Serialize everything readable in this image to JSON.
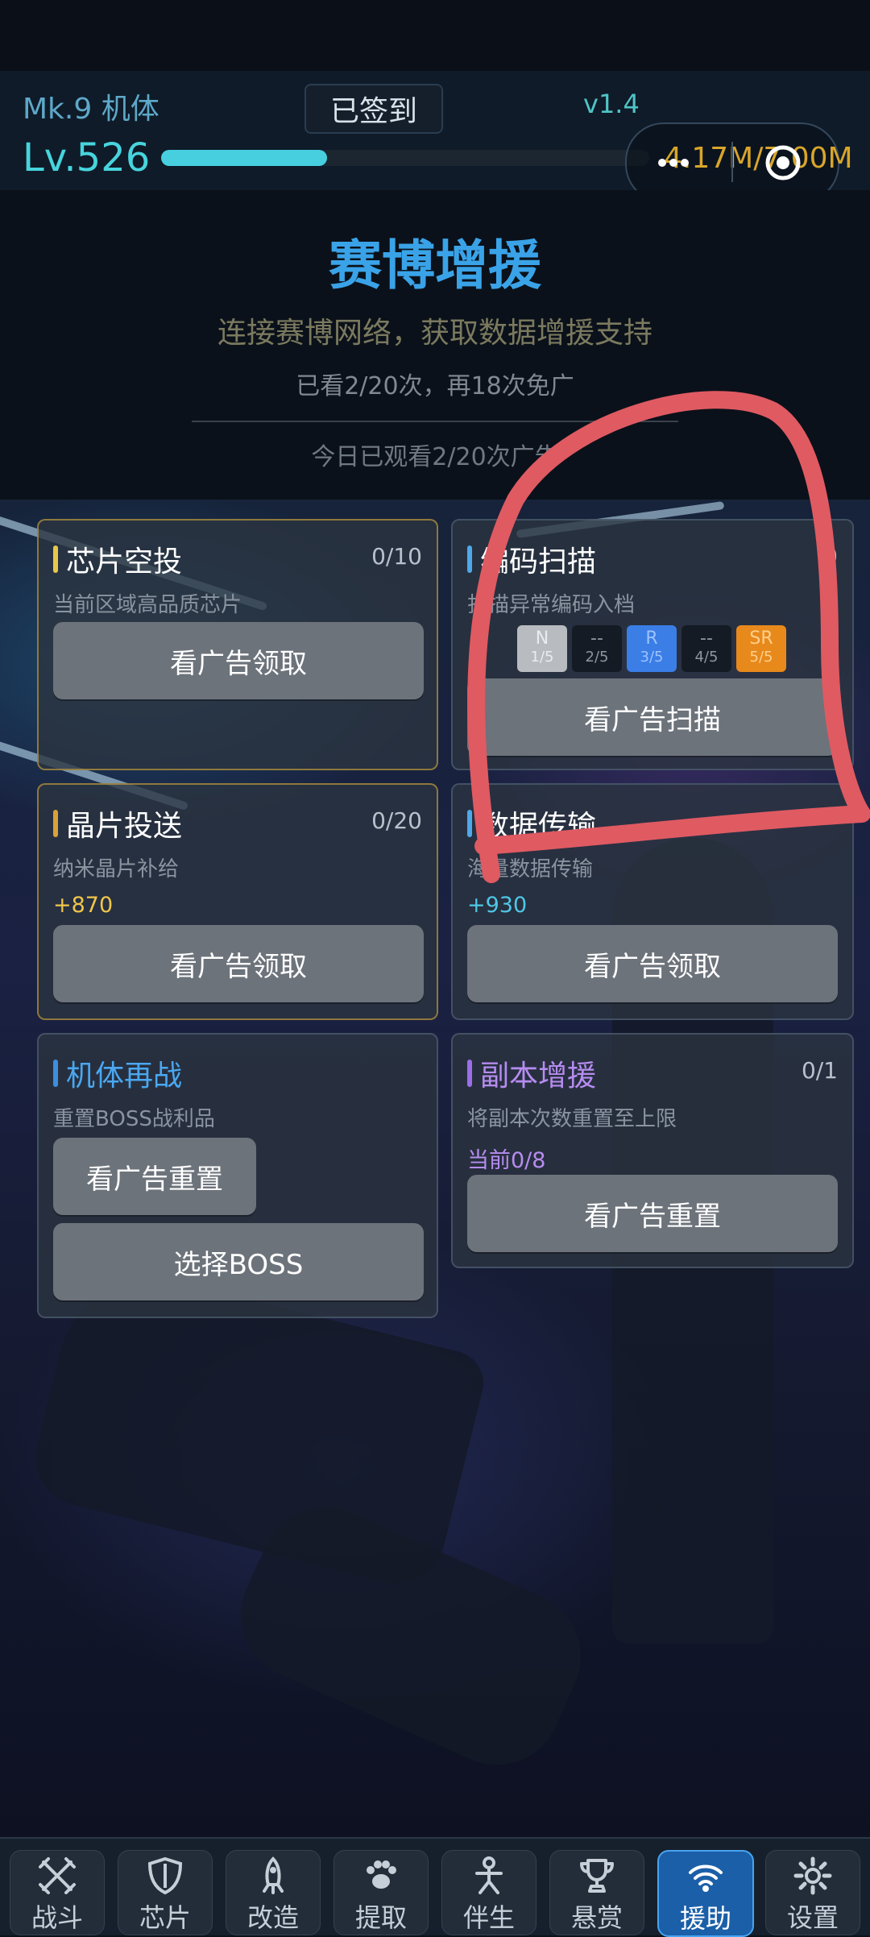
{
  "header": {
    "mech_name": "Mk.9 机体",
    "signin_label": "已签到",
    "version": "v1.4",
    "level": "Lv.526",
    "xp_progress": 0.34,
    "power_text": "4.17M/7.00M"
  },
  "intro": {
    "title": "赛博增援",
    "subtitle": "连接赛博网络，获取数据增援支持",
    "watch_count": "已看2/20次，再18次免广",
    "today_count": "今日已观看2/20次广告"
  },
  "cards": {
    "chip_airdrop": {
      "title": "芯片空投",
      "count": "0/10",
      "desc": "当前区域高品质芯片",
      "button": "看广告领取",
      "accent": "#e8c84a"
    },
    "code_scan": {
      "title": "编码扫描",
      "count": "0",
      "desc": "扫描异常编码入档",
      "button": "看广告扫描",
      "rarities": [
        {
          "name": "N",
          "count": "1/5",
          "bg": "#b8bcc0",
          "color": "#e9ecef"
        },
        {
          "name": "--",
          "count": "2/5",
          "bg": "#151b24",
          "color": "#8c96a2"
        },
        {
          "name": "R",
          "count": "3/5",
          "bg": "#3a7ee6",
          "color": "#9cc2ff"
        },
        {
          "name": "--",
          "count": "4/5",
          "bg": "#151b24",
          "color": "#8c96a2"
        },
        {
          "name": "SR",
          "count": "5/5",
          "bg": "#e8891c",
          "color": "#ffd08a"
        }
      ]
    },
    "crystal_delivery": {
      "title": "晶片投送",
      "count": "0/20",
      "desc": "纳米晶片补给",
      "bonus": "+870",
      "bonus_color": "#f0c64a",
      "button": "看广告领取",
      "accent": "#d8a23a"
    },
    "data_transfer": {
      "title": "数据传输",
      "desc": "海量数据传输",
      "bonus": "+930",
      "bonus_color": "#4fc7e6",
      "button": "看广告领取"
    },
    "mech_rebattle": {
      "title": "机体再战",
      "desc": "重置BOSS战利品",
      "button_reset": "看广告重置",
      "button_select": "选择BOSS",
      "accent": "#3c8fe0",
      "title_color": "#4aa8f0"
    },
    "dungeon_boost": {
      "title": "副本增援",
      "count": "0/1",
      "desc": "将副本次数重置至上限",
      "current": "当前0/8",
      "current_color": "#b68cf0",
      "button": "看广告重置",
      "accent": "#9b6ee8",
      "title_color": "#b68cf0"
    }
  },
  "nav": [
    {
      "label": "战斗",
      "icon": "crossed-swords-icon"
    },
    {
      "label": "芯片",
      "icon": "shield-icon"
    },
    {
      "label": "改造",
      "icon": "rocket-icon"
    },
    {
      "label": "提取",
      "icon": "paw-icon"
    },
    {
      "label": "伴生",
      "icon": "person-icon"
    },
    {
      "label": "悬赏",
      "icon": "trophy-icon"
    },
    {
      "label": "援助",
      "icon": "signal-icon",
      "active": true
    },
    {
      "label": "设置",
      "icon": "gear-icon"
    }
  ],
  "colors": {
    "annotation": "#e05a62",
    "active_nav": "#1b5fa8"
  }
}
